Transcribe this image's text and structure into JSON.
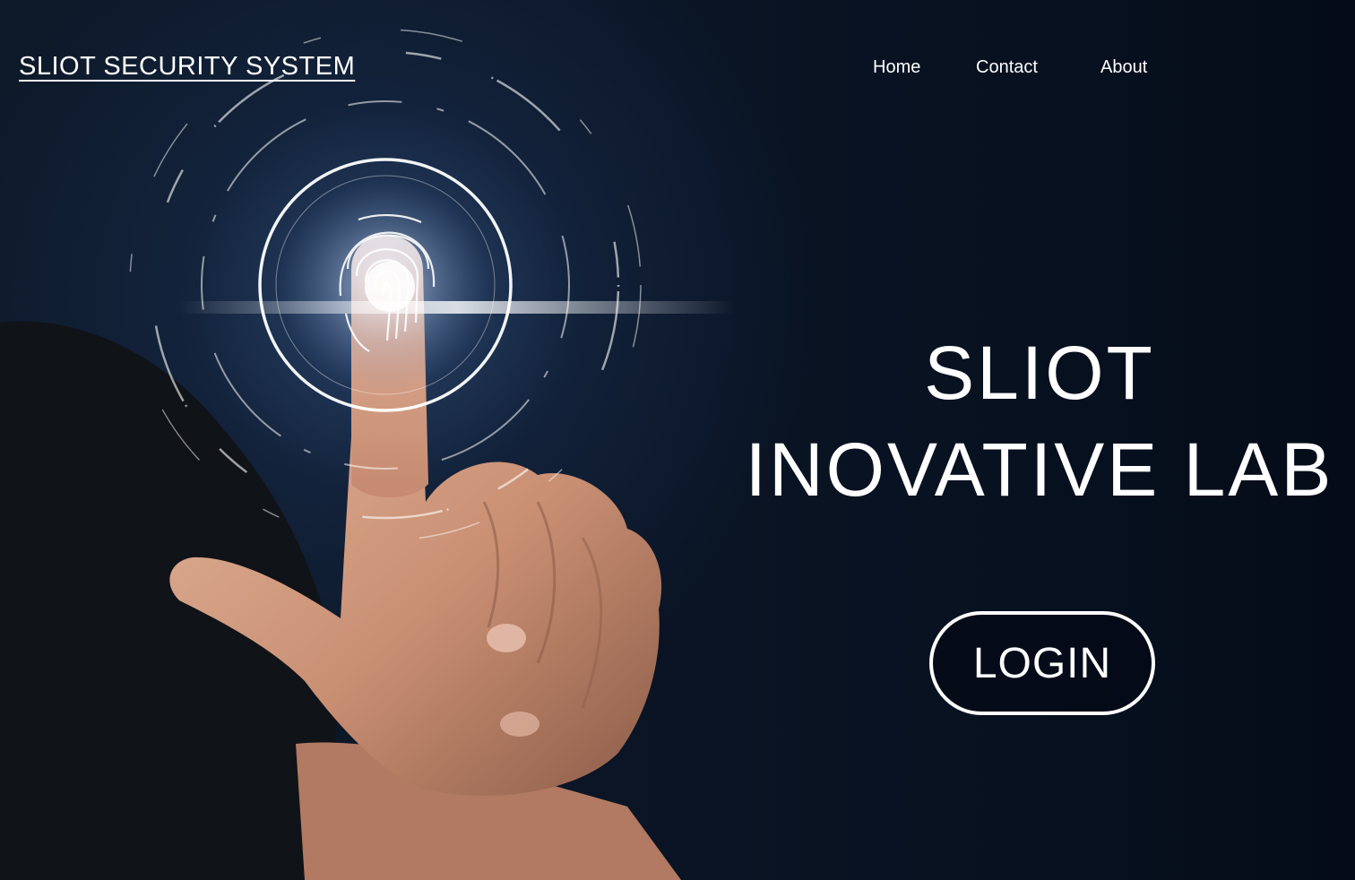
{
  "header": {
    "brand": "SLIOT SECURITY SYSTEM",
    "nav": [
      {
        "label": "Home"
      },
      {
        "label": "Contact"
      },
      {
        "label": "About"
      }
    ]
  },
  "hero": {
    "headline_line1": "SLIOT",
    "headline_line2": "INOVATIVE LAB",
    "login_label": "LOGIN",
    "image_subject": "hand-touching-fingerprint-scanner"
  },
  "colors": {
    "background": "#0b1525",
    "text": "#ffffff",
    "glow": "#cfe2ff"
  }
}
